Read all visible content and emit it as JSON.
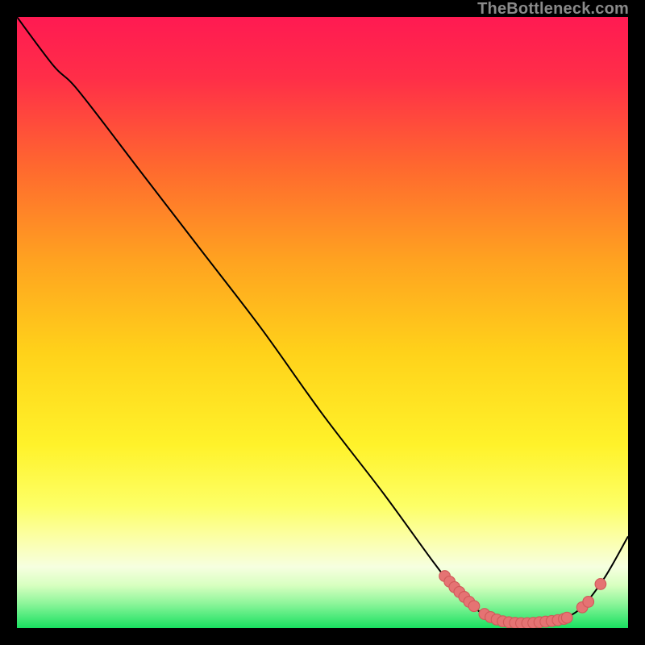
{
  "attribution": "TheBottleneck.com",
  "colors": {
    "curve_stroke": "#000000",
    "marker_fill": "#e57373",
    "marker_stroke": "#d05a5a"
  },
  "chart_data": {
    "type": "line",
    "title": "",
    "xlabel": "",
    "ylabel": "",
    "xlim": [
      0,
      100
    ],
    "ylim": [
      0,
      100
    ],
    "curve": [
      {
        "x": 0,
        "y": 100
      },
      {
        "x": 6,
        "y": 92
      },
      {
        "x": 10,
        "y": 88
      },
      {
        "x": 20,
        "y": 75
      },
      {
        "x": 30,
        "y": 62
      },
      {
        "x": 40,
        "y": 49
      },
      {
        "x": 50,
        "y": 35
      },
      {
        "x": 60,
        "y": 22
      },
      {
        "x": 68,
        "y": 11
      },
      {
        "x": 72,
        "y": 6
      },
      {
        "x": 76,
        "y": 2.5
      },
      {
        "x": 80,
        "y": 1.0
      },
      {
        "x": 84,
        "y": 0.8
      },
      {
        "x": 88,
        "y": 1.2
      },
      {
        "x": 92,
        "y": 3.0
      },
      {
        "x": 96,
        "y": 8
      },
      {
        "x": 100,
        "y": 15
      }
    ],
    "markers": [
      {
        "x": 70.0,
        "y": 8.5
      },
      {
        "x": 70.8,
        "y": 7.6
      },
      {
        "x": 71.6,
        "y": 6.7
      },
      {
        "x": 72.4,
        "y": 5.9
      },
      {
        "x": 73.2,
        "y": 5.1
      },
      {
        "x": 74.0,
        "y": 4.3
      },
      {
        "x": 74.8,
        "y": 3.6
      },
      {
        "x": 76.5,
        "y": 2.3
      },
      {
        "x": 77.5,
        "y": 1.8
      },
      {
        "x": 78.5,
        "y": 1.4
      },
      {
        "x": 79.5,
        "y": 1.1
      },
      {
        "x": 80.5,
        "y": 0.95
      },
      {
        "x": 81.5,
        "y": 0.85
      },
      {
        "x": 82.5,
        "y": 0.8
      },
      {
        "x": 83.5,
        "y": 0.8
      },
      {
        "x": 84.5,
        "y": 0.85
      },
      {
        "x": 85.5,
        "y": 0.95
      },
      {
        "x": 86.5,
        "y": 1.05
      },
      {
        "x": 87.5,
        "y": 1.15
      },
      {
        "x": 88.5,
        "y": 1.3
      },
      {
        "x": 89.5,
        "y": 1.5
      },
      {
        "x": 90.0,
        "y": 1.7
      },
      {
        "x": 92.5,
        "y": 3.4
      },
      {
        "x": 93.5,
        "y": 4.3
      },
      {
        "x": 95.5,
        "y": 7.2
      }
    ]
  }
}
